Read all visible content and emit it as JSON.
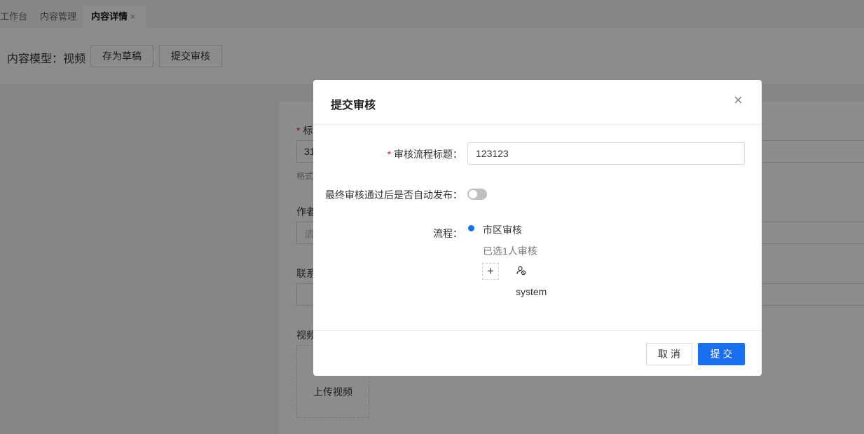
{
  "tabs": [
    {
      "label": "工作台"
    },
    {
      "label": "内容管理"
    },
    {
      "label": "内容详情",
      "close": "×"
    }
  ],
  "toolbar": {
    "model_label": "内容模型：视频",
    "draft": "存为草稿",
    "submit": "提交审核"
  },
  "form": {
    "title_star": "*",
    "title_label": "标",
    "title_value": "31",
    "title_hint": "格式",
    "author_label": "作者",
    "author_placeholder": "请",
    "contact_label": "联系",
    "video_label": "视频",
    "upload": "上传视频"
  },
  "modal": {
    "title": "提交审核",
    "close": "×",
    "flow_title_label": "审核流程标题：",
    "flow_title_value": "123123",
    "auto_publish_label": "最终审核通过后是否自动发布：",
    "auto_publish": false,
    "flow_label": "流程：",
    "step_name": "市区审核",
    "step_info": "已选1人审核",
    "add": "+",
    "reviewer": "system",
    "cancel": "取 消",
    "ok": "提 交",
    "accent": "#1a6ef0"
  }
}
